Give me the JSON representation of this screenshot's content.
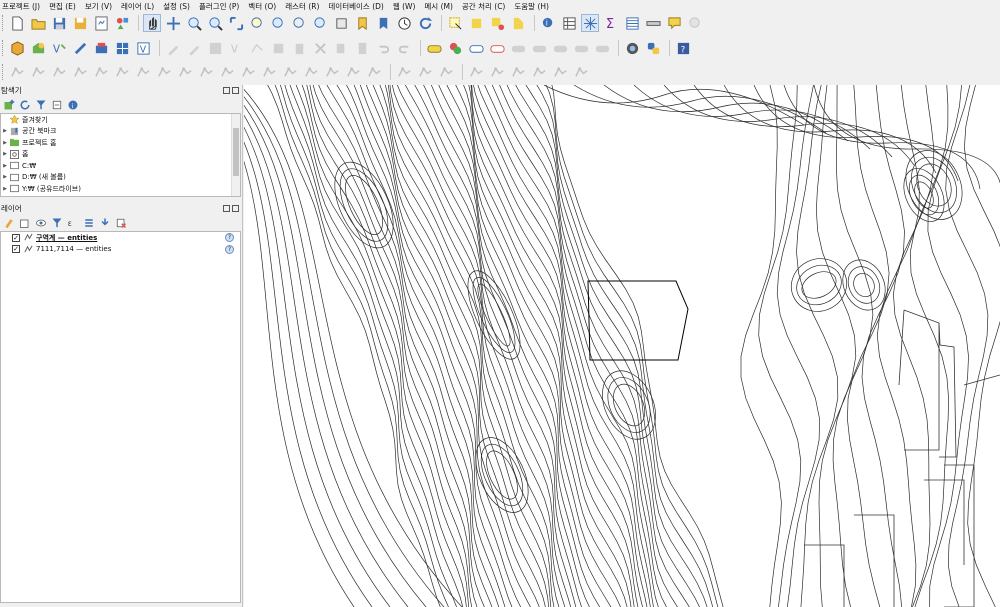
{
  "menu": [
    "프로젝트 (J)",
    "편집 (E)",
    "보기 (V)",
    "레이어 (L)",
    "설정 (S)",
    "플러그인 (P)",
    "벡터 (O)",
    "래스터 (R)",
    "데이터베이스 (D)",
    "웹 (W)",
    "메시 (M)",
    "공간 처리 (C)",
    "도움말 (H)"
  ],
  "browser": {
    "title": "탐색기",
    "items": [
      {
        "label": "즐겨찾기",
        "icon": "star-icon",
        "expandable": false
      },
      {
        "label": "공간 북마크",
        "icon": "bookmark-icon",
        "expandable": true
      },
      {
        "label": "프로젝트 홈",
        "icon": "project-home-icon",
        "expandable": true
      },
      {
        "label": "홈",
        "icon": "home-folder-icon",
        "expandable": true
      },
      {
        "label": "C:₩",
        "icon": "drive-icon",
        "expandable": true
      },
      {
        "label": "D:₩ (새 볼륨)",
        "icon": "drive-icon",
        "expandable": true
      },
      {
        "label": "Y:₩ (공유드라이브)",
        "icon": "drive-icon",
        "expandable": true
      }
    ]
  },
  "layers": {
    "title": "레이어",
    "items": [
      {
        "label": "구역계 — entities",
        "checked": true,
        "bold": true
      },
      {
        "label": "7111,7114 — entities",
        "checked": true,
        "bold": false
      }
    ]
  },
  "icons": {
    "toolbar1": [
      "new-project-icon",
      "open-project-icon",
      "save-project-icon",
      "save-as-icon",
      "print-layout-icon",
      "style-manager-icon",
      "pan-icon",
      "pan-to-selection-icon",
      "zoom-in-icon",
      "zoom-out-icon",
      "zoom-full-icon",
      "zoom-selection-icon",
      "zoom-layer-icon",
      "zoom-native-icon",
      "zoom-last-icon",
      "zoom-next-icon",
      "new-bookmark-icon",
      "show-bookmarks-icon",
      "temporal-icon",
      "refresh-icon",
      "select-feature-icon",
      "select-value-icon",
      "deselect-icon",
      "identify-icon",
      "attribute-table-icon",
      "field-calc-icon",
      "stats-icon",
      "open-table-icon",
      "measure-icon",
      "map-tips-icon",
      "locator-icon"
    ],
    "toolbar2": [
      "data-source-manager-icon",
      "new-gpkg-icon",
      "new-shapefile-icon",
      "new-scratch-icon",
      "digitize-icon",
      "mesh-icon",
      "virtual-layer-icon",
      "edit-pencil-icon",
      "save-edits-icon",
      "add-feature-icon",
      "vertex-tool-icon",
      "node-icon",
      "delete-icon",
      "cut-icon",
      "copy-icon",
      "paste-icon",
      "undo-icon",
      "redo-icon",
      "label-icon",
      "label-pin-icon",
      "label-highlight-icon",
      "label-move-icon",
      "label-rotate-icon",
      "label-change-icon",
      "label-show-icon",
      "label-hide-icon",
      "python-console-icon",
      "plugin-icon",
      "help-icon"
    ]
  },
  "colors": {
    "contour": "#2a2a2a",
    "boundary": "#000000",
    "accent_blue": "#3b6fb6"
  }
}
